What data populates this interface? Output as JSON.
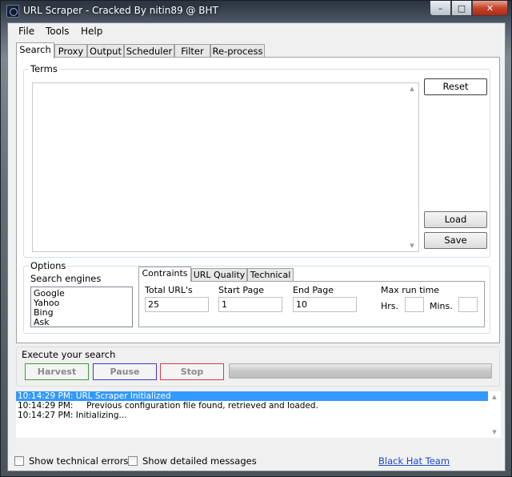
{
  "window": {
    "title": "URL Scraper - Cracked By nitin89 @ BHT",
    "caption_buttons": {
      "minimize": "–",
      "maximize": "□",
      "close": "✕"
    }
  },
  "menu": [
    "File",
    "Tools",
    "Help"
  ],
  "tabs": [
    {
      "label": "Search",
      "active": true
    },
    {
      "label": "Proxy"
    },
    {
      "label": "Output"
    },
    {
      "label": "Scheduler"
    },
    {
      "label": "Filter"
    },
    {
      "label": "Re-process"
    }
  ],
  "terms": {
    "group_label": "Terms",
    "value": "",
    "reset_label": "Reset",
    "load_label": "Load",
    "save_label": "Save"
  },
  "options": {
    "group_label": "Options",
    "search_engines_label": "Search engines",
    "engines": [
      "Google",
      "Yahoo",
      "Bing",
      "Ask"
    ],
    "subtabs": [
      {
        "label": "Contraints",
        "active": true
      },
      {
        "label": "URL Quality"
      },
      {
        "label": "Technical"
      }
    ],
    "total_urls_label": "Total URL's",
    "total_urls": "25",
    "start_page_label": "Start Page",
    "start_page": "1",
    "end_page_label": "End Page",
    "end_page": "10",
    "max_run_time_label": "Max run time",
    "hrs_label": "Hrs.",
    "hrs": "",
    "mins_label": "Mins.",
    "mins": ""
  },
  "execute": {
    "label": "Execute your search",
    "harvest_label": "Harvest",
    "pause_label": "Pause",
    "stop_label": "Stop",
    "progress": 0
  },
  "log": [
    "10:14:29 PM: URL Scraper Initialized",
    "10:14:29 PM:     Previous configuration file found, retrieved and loaded.",
    "10:14:27 PM: Initializing..."
  ],
  "footer": {
    "show_technical_errors": "Show technical errors",
    "show_detailed_messages": "Show detailed messages",
    "link": "Black Hat Team"
  },
  "colors": {
    "harvest_border": "#3a9a3a",
    "pause_border": "#3a3ad8",
    "stop_border": "#d83a4a",
    "selection": "#3399ff",
    "link": "#1a4bd0"
  }
}
